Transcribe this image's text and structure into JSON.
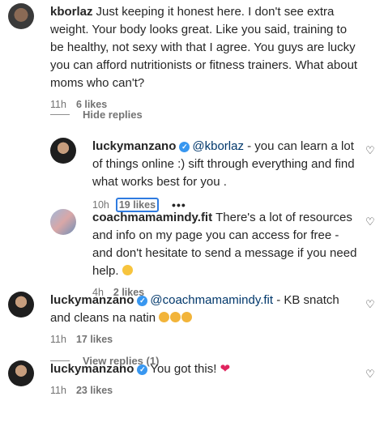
{
  "comments": [
    {
      "username": "kborlaz",
      "text": "Just keeping it honest here. I don't see extra weight. Your body looks great. Like you said, training to be healthy, not sexy with that I agree. You guys are lucky you can afford nutritionists or fitness trainers. What about moms who can't?",
      "time": "11h",
      "likes": "6 likes"
    }
  ],
  "hide_replies": "Hide replies",
  "replies": [
    {
      "username": "luckymanzano",
      "mention": "@kborlaz",
      "text": " - you can learn a lot of things online :) sift through everything and find what works best for you .",
      "time": "10h",
      "likes": "19 likes",
      "more": "•••"
    },
    {
      "username": "coachmamamindy.fit",
      "text": "There's a lot of resources and info on my page you can access for free - and don't hesitate to send a message if you need help.",
      "time": "4h",
      "likes": "2 likes"
    }
  ],
  "comment2": {
    "username": "luckymanzano",
    "mention": "@coachmamamindy.fit",
    "text": " - KB snatch and cleans na natin",
    "time": "11h",
    "likes": "17 likes"
  },
  "view_replies": "View replies (1)",
  "comment3": {
    "username": "luckymanzano",
    "text": "You got this!",
    "time": "11h",
    "likes": "23 likes"
  },
  "icons": {
    "heart": "heart-outline-icon",
    "verified": "verified-badge-icon"
  },
  "colors": {
    "mention": "#00376b",
    "verified": "#3897f0",
    "meta": "#737373"
  }
}
